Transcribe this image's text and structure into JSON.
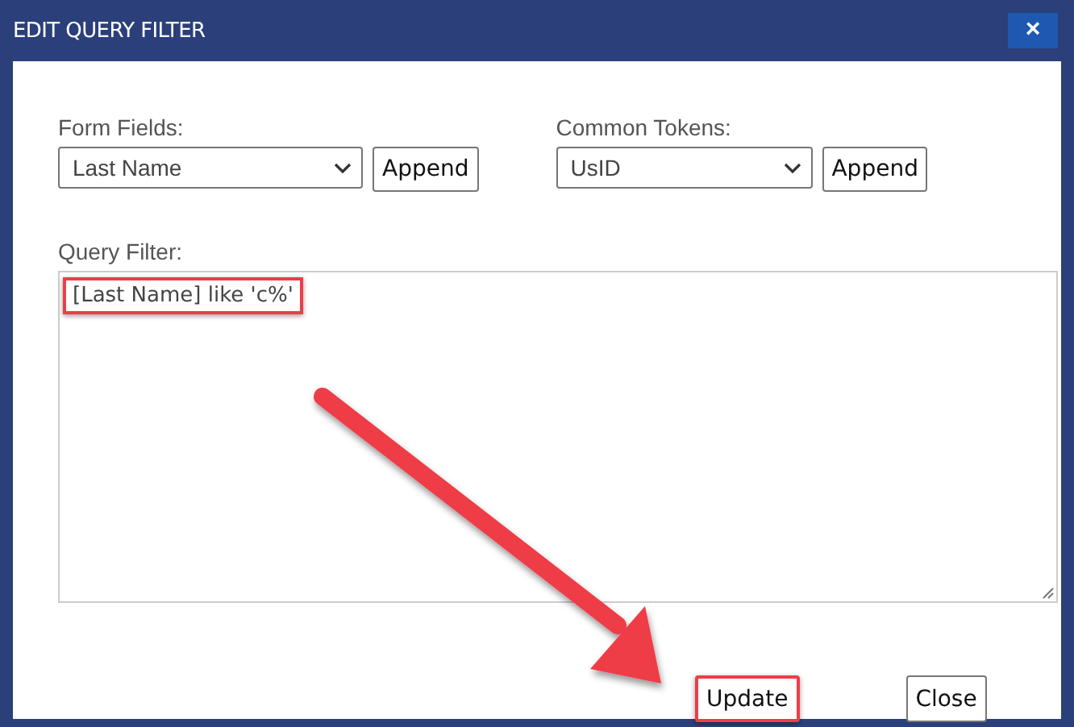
{
  "window": {
    "title": "EDIT QUERY FILTER",
    "close_icon": "×"
  },
  "pickers": [
    {
      "label": "Form Fields:",
      "value": "Last Name",
      "button": "Append"
    },
    {
      "label": "Common Tokens:",
      "value": "UsID",
      "button": "Append"
    }
  ],
  "query_filter": {
    "label": "Query Filter:",
    "value": "[Last Name] like 'c%'",
    "highlighted": true
  },
  "buttons": [
    {
      "label": "Update",
      "highlighted": true
    },
    {
      "label": "Close",
      "highlighted": false
    }
  ],
  "annotation": {
    "arrow": true
  }
}
